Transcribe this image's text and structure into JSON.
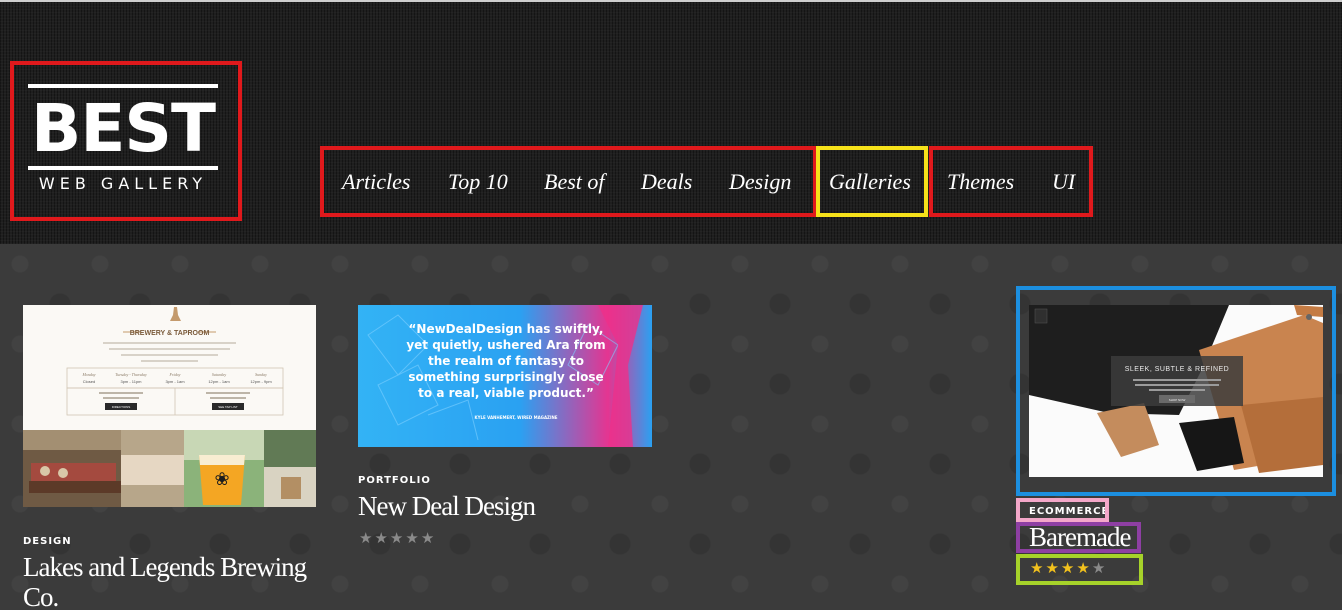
{
  "logo": {
    "word": "BEST",
    "sub": "WEB GALLERY"
  },
  "nav": [
    "Articles",
    "Top 10",
    "Best of",
    "Deals",
    "Design",
    "Galleries",
    "Themes",
    "UI"
  ],
  "cards": [
    {
      "category": "DESIGN",
      "title_line1": "Lakes and Legends Brewing",
      "title_line2": "Co.",
      "thumb": {
        "heading": "BREWERY & TAPROOM",
        "days": [
          "Monday",
          "Tuesday - Thursday",
          "Friday",
          "Saturday",
          "Sunday"
        ],
        "hours": [
          "Closed",
          "3pm - 11pm",
          "3pm - 1am",
          "12pm - 1am",
          "12pm - 9pm"
        ],
        "btn1": "DIRECTIONS",
        "btn2": "SEE TAP LIST"
      }
    },
    {
      "category": "PORTFOLIO",
      "title": "New Deal Design",
      "rating": 0,
      "thumb": {
        "quote_lines": [
          "“NewDealDesign has swiftly,",
          "yet quietly, ushered Ara from",
          "the realm of fantasy to",
          "something surprisingly close",
          "to a real, viable product.”"
        ],
        "attribution": "KYLE VANHEMERT, WIRED MAGAZINE"
      }
    },
    {
      "category": "ECOMMERCE",
      "title": "Baremade",
      "rating": 4,
      "thumb": {
        "heading": "SLEEK, SUBTLE & REFINED",
        "button": "SHOP NOW"
      }
    }
  ],
  "colors": {
    "annotation_red": "#e0191c",
    "annotation_yellow": "#f6e21a",
    "annotation_blue": "#1c8fe0",
    "annotation_pink": "#f3a7c9",
    "annotation_purple": "#8e3fa3",
    "annotation_green": "#a6d22a",
    "star": "#f2c11d"
  }
}
